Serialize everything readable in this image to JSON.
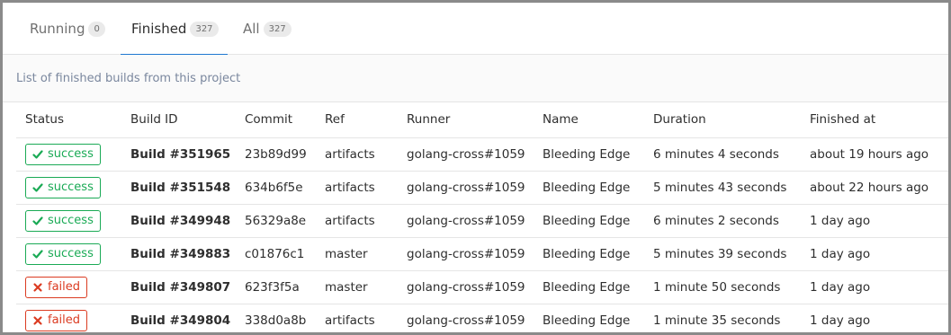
{
  "tabs": [
    {
      "label": "Running",
      "count": "0"
    },
    {
      "label": "Finished",
      "count": "327"
    },
    {
      "label": "All",
      "count": "327"
    }
  ],
  "info_text": "List of finished builds from this project",
  "columns": [
    "Status",
    "Build ID",
    "Commit",
    "Ref",
    "Runner",
    "Name",
    "Duration",
    "Finished at"
  ],
  "colors": {
    "success": "#1aaa55",
    "failed": "#db3b21",
    "active_tab": "#1f78d1"
  },
  "builds": [
    {
      "status": "success",
      "status_icon": "check-icon",
      "build_id": "Build #351965",
      "commit": "23b89d99",
      "ref": "artifacts",
      "runner": "golang-cross#1059",
      "name": "Bleeding Edge",
      "duration": "6 minutes 4 seconds",
      "finished_at": "about 19 hours ago"
    },
    {
      "status": "success",
      "status_icon": "check-icon",
      "build_id": "Build #351548",
      "commit": "634b6f5e",
      "ref": "artifacts",
      "runner": "golang-cross#1059",
      "name": "Bleeding Edge",
      "duration": "5 minutes 43 seconds",
      "finished_at": "about 22 hours ago"
    },
    {
      "status": "success",
      "status_icon": "check-icon",
      "build_id": "Build #349948",
      "commit": "56329a8e",
      "ref": "artifacts",
      "runner": "golang-cross#1059",
      "name": "Bleeding Edge",
      "duration": "6 minutes 2 seconds",
      "finished_at": "1 day ago"
    },
    {
      "status": "success",
      "status_icon": "check-icon",
      "build_id": "Build #349883",
      "commit": "c01876c1",
      "ref": "master",
      "runner": "golang-cross#1059",
      "name": "Bleeding Edge",
      "duration": "5 minutes 39 seconds",
      "finished_at": "1 day ago"
    },
    {
      "status": "failed",
      "status_icon": "x-icon",
      "build_id": "Build #349807",
      "commit": "623f3f5a",
      "ref": "master",
      "runner": "golang-cross#1059",
      "name": "Bleeding Edge",
      "duration": "1 minute 50 seconds",
      "finished_at": "1 day ago"
    },
    {
      "status": "failed",
      "status_icon": "x-icon",
      "build_id": "Build #349804",
      "commit": "338d0a8b",
      "ref": "artifacts",
      "runner": "golang-cross#1059",
      "name": "Bleeding Edge",
      "duration": "1 minute 35 seconds",
      "finished_at": "1 day ago"
    }
  ]
}
